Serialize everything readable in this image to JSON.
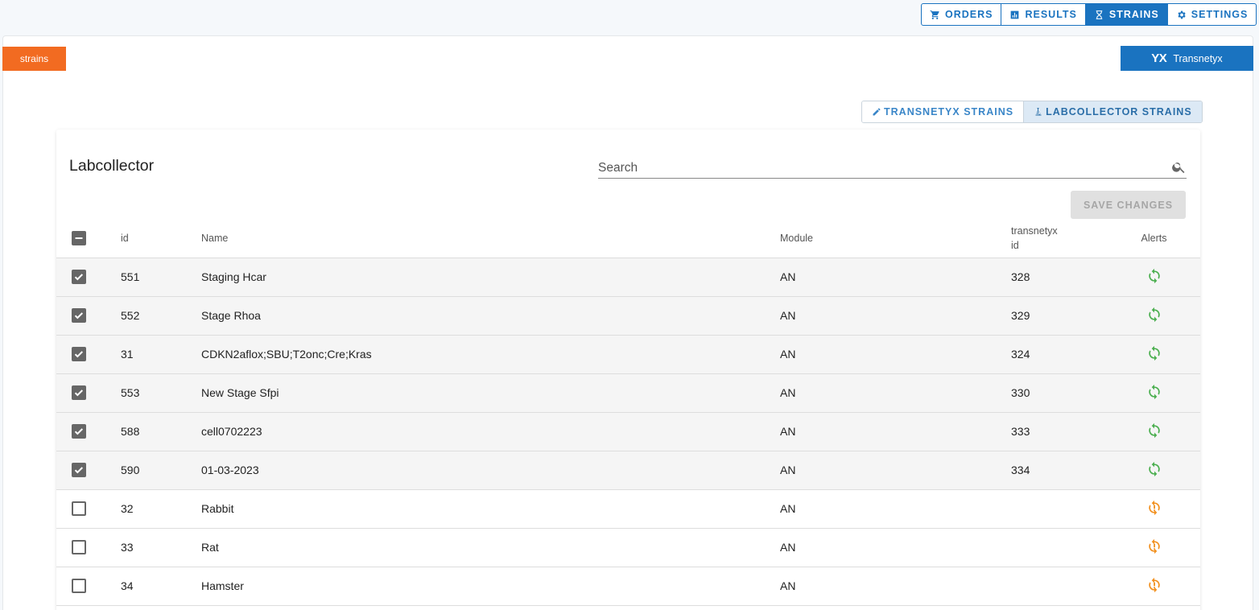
{
  "nav": [
    {
      "label": "ORDERS",
      "icon": "cart-icon",
      "active": false
    },
    {
      "label": "RESULTS",
      "icon": "chart-icon",
      "active": false
    },
    {
      "label": "STRAINS",
      "icon": "hourglass-icon",
      "active": true
    },
    {
      "label": "SETTINGS",
      "icon": "gear-icon",
      "active": false
    }
  ],
  "tag_label": "strains",
  "brand": {
    "logo": "YX",
    "label": "Transnetyx"
  },
  "subtabs": [
    {
      "label": "TRANSNETYX STRAINS",
      "icon": "pencil-icon",
      "active": false
    },
    {
      "label": "LABCOLLECTOR STRAINS",
      "icon": "microscope-icon",
      "active": true
    }
  ],
  "card": {
    "title": "Labcollector",
    "search_placeholder": "Search",
    "save_label": "SAVE CHANGES"
  },
  "columns": {
    "id": "id",
    "name": "Name",
    "module": "Module",
    "transnetyx_id_1": "transnetyx",
    "transnetyx_id_2": "id",
    "alerts": "Alerts"
  },
  "rows": [
    {
      "checked": true,
      "id": "551",
      "name": "Staging Hcar",
      "module": "AN",
      "transnetyx_id": "328",
      "alert": "synced"
    },
    {
      "checked": true,
      "id": "552",
      "name": "Stage Rhoa",
      "module": "AN",
      "transnetyx_id": "329",
      "alert": "synced"
    },
    {
      "checked": true,
      "id": "31",
      "name": "CDKN2aflox;SBU;T2onc;Cre;Kras",
      "module": "AN",
      "transnetyx_id": "324",
      "alert": "synced"
    },
    {
      "checked": true,
      "id": "553",
      "name": "New Stage Sfpi",
      "module": "AN",
      "transnetyx_id": "330",
      "alert": "synced"
    },
    {
      "checked": true,
      "id": "588",
      "name": "cell0702223",
      "module": "AN",
      "transnetyx_id": "333",
      "alert": "synced"
    },
    {
      "checked": true,
      "id": "590",
      "name": "01-03-2023",
      "module": "AN",
      "transnetyx_id": "334",
      "alert": "synced"
    },
    {
      "checked": false,
      "id": "32",
      "name": "Rabbit",
      "module": "AN",
      "transnetyx_id": "",
      "alert": "warning"
    },
    {
      "checked": false,
      "id": "33",
      "name": "Rat",
      "module": "AN",
      "transnetyx_id": "",
      "alert": "warning"
    },
    {
      "checked": false,
      "id": "34",
      "name": "Hamster",
      "module": "AN",
      "transnetyx_id": "",
      "alert": "warning"
    }
  ],
  "colors": {
    "primary": "#1a73c0",
    "tag": "#f26b21",
    "synced": "#4caf50",
    "warning": "#f29222"
  }
}
